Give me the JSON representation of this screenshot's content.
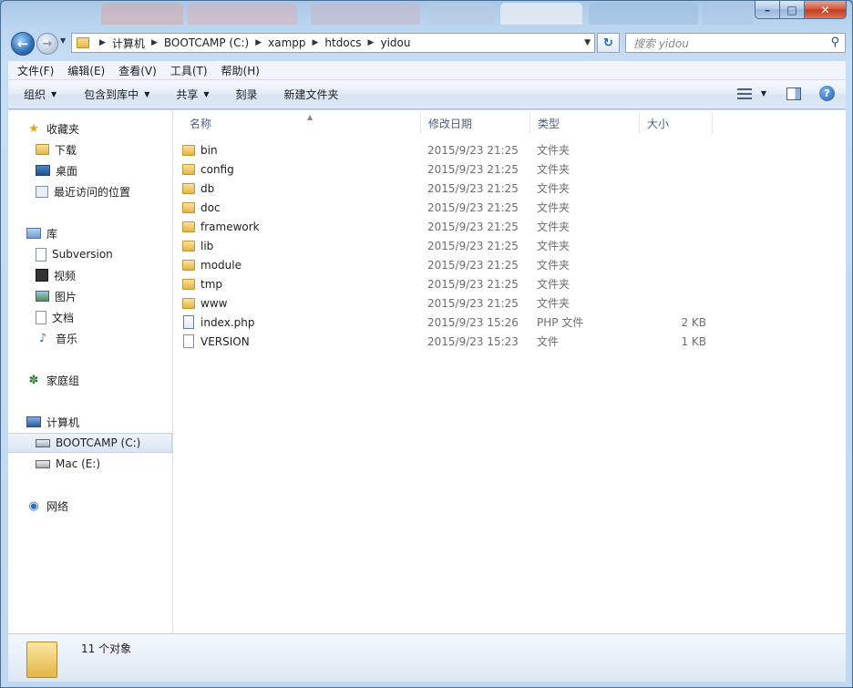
{
  "window": {
    "caption_buttons": {
      "minimize": "–",
      "maximize": "□",
      "close": "✕"
    }
  },
  "nav": {
    "back_glyph": "←",
    "forward_glyph": "→",
    "breadcrumb": [
      "计算机",
      "BOOTCAMP (C:)",
      "xampp",
      "htdocs",
      "yidou"
    ],
    "search_placeholder": "搜索 yidou",
    "icons": {
      "back": "back-arrow-icon",
      "forward": "forward-arrow-icon",
      "refresh": "refresh-icon",
      "search": "search-icon"
    }
  },
  "menu": [
    "文件(F)",
    "编辑(E)",
    "查看(V)",
    "工具(T)",
    "帮助(H)"
  ],
  "commands": {
    "organize": "组织",
    "include_in_library": "包含到库中",
    "share": "共享",
    "burn": "刻录",
    "new_folder": "新建文件夹"
  },
  "sidebar": {
    "favorites": {
      "label": "收藏夹",
      "items": [
        "下载",
        "桌面",
        "最近访问的位置"
      ]
    },
    "libraries": {
      "label": "库",
      "items": [
        "Subversion",
        "视频",
        "图片",
        "文档",
        "音乐"
      ]
    },
    "homegroup": {
      "label": "家庭组"
    },
    "computer": {
      "label": "计算机",
      "items": [
        "BOOTCAMP (C:)",
        "Mac (E:)"
      ],
      "selected": "BOOTCAMP (C:)"
    },
    "network": {
      "label": "网络"
    }
  },
  "columns": {
    "name": "名称",
    "date": "修改日期",
    "type": "类型",
    "size": "大小"
  },
  "files": [
    {
      "name": "bin",
      "date": "2015/9/23 21:25",
      "type": "文件夹",
      "size": "",
      "kind": "folder"
    },
    {
      "name": "config",
      "date": "2015/9/23 21:25",
      "type": "文件夹",
      "size": "",
      "kind": "folder"
    },
    {
      "name": "db",
      "date": "2015/9/23 21:25",
      "type": "文件夹",
      "size": "",
      "kind": "folder"
    },
    {
      "name": "doc",
      "date": "2015/9/23 21:25",
      "type": "文件夹",
      "size": "",
      "kind": "folder"
    },
    {
      "name": "framework",
      "date": "2015/9/23 21:25",
      "type": "文件夹",
      "size": "",
      "kind": "folder"
    },
    {
      "name": "lib",
      "date": "2015/9/23 21:25",
      "type": "文件夹",
      "size": "",
      "kind": "folder"
    },
    {
      "name": "module",
      "date": "2015/9/23 21:25",
      "type": "文件夹",
      "size": "",
      "kind": "folder"
    },
    {
      "name": "tmp",
      "date": "2015/9/23 21:25",
      "type": "文件夹",
      "size": "",
      "kind": "folder"
    },
    {
      "name": "www",
      "date": "2015/9/23 21:25",
      "type": "文件夹",
      "size": "",
      "kind": "folder"
    },
    {
      "name": "index.php",
      "date": "2015/9/23 15:26",
      "type": "PHP 文件",
      "size": "2 KB",
      "kind": "php"
    },
    {
      "name": "VERSION",
      "date": "2015/9/23 15:23",
      "type": "文件",
      "size": "1 KB",
      "kind": "file"
    }
  ],
  "status": {
    "count": "11 个对象"
  }
}
